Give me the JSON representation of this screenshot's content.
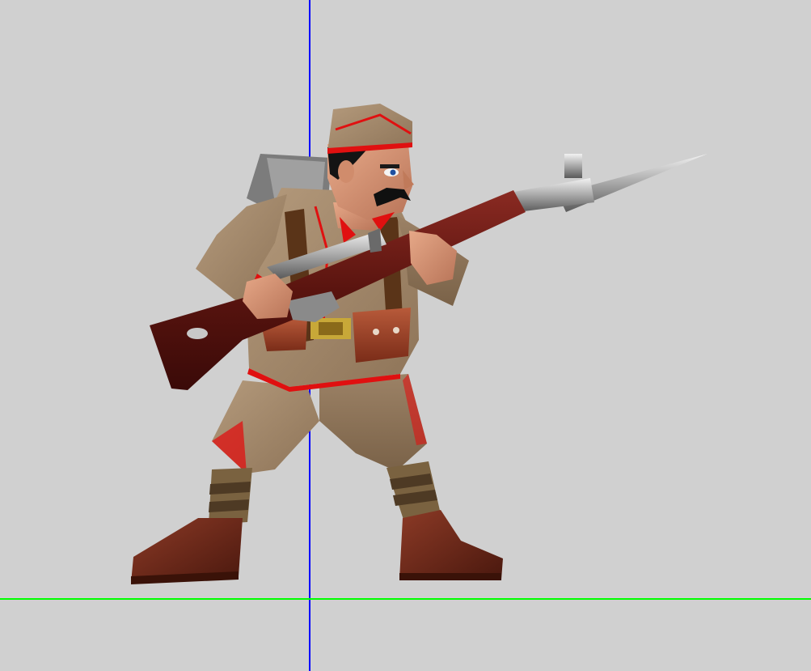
{
  "viewport": {
    "background_color": "#d0d0d0",
    "vertical_axis_color": "#0000ff",
    "horizontal_axis_color": "#00ff00"
  },
  "model": {
    "subject": "rifleman",
    "pose": "bayonet-ready",
    "uniform_color": "#a88d6e",
    "trim_color": "#e01010",
    "rifle_stock_color": "#6a1a14",
    "boot_color": "#6b2a1a"
  }
}
